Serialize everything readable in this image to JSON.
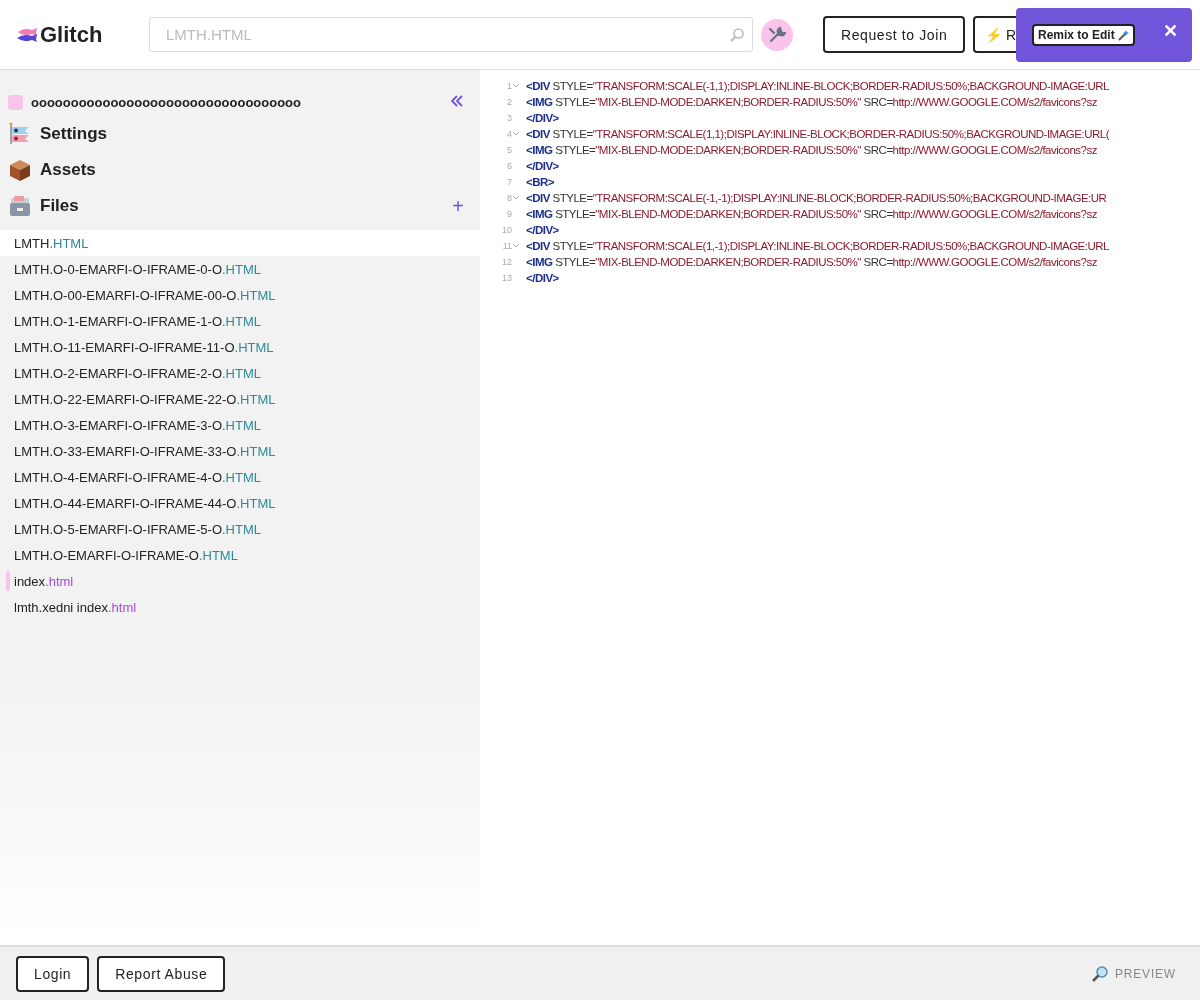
{
  "header": {
    "logo_text": "Glitch",
    "search": {
      "value": "LMTH.HTML"
    },
    "buttons": [
      {
        "kind": "outline",
        "label": "Request to Join"
      },
      {
        "kind": "lightning",
        "icon": "⚡",
        "label": "R"
      }
    ],
    "popover": {
      "button": "Remix to Edit",
      "close": "✕"
    }
  },
  "sidebar": {
    "project_name": "oooooooooooooooooooooooooooooooooo",
    "sections": [
      {
        "kind": "settings",
        "label": "Settings"
      },
      {
        "kind": "assets",
        "label": "Assets"
      },
      {
        "kind": "files",
        "label": "Files",
        "add": "+"
      }
    ],
    "files": [
      {
        "name": "LMTH",
        "ext": ".HTML",
        "color": "#2a8a96",
        "selected": true,
        "marked": false
      },
      {
        "name": "LMTH.O-0-EMARFI-O-IFRAME-0-O",
        "ext": ".HTML",
        "color": "#2a8a96",
        "selected": false,
        "marked": false
      },
      {
        "name": "LMTH.O-00-EMARFI-O-IFRAME-00-O",
        "ext": ".HTML",
        "color": "#2a8a96",
        "selected": false,
        "marked": false
      },
      {
        "name": "LMTH.O-1-EMARFI-O-IFRAME-1-O",
        "ext": ".HTML",
        "color": "#2a8a96",
        "selected": false,
        "marked": false
      },
      {
        "name": "LMTH.O-11-EMARFI-O-IFRAME-11-O",
        "ext": ".HTML",
        "color": "#2a8a96",
        "selected": false,
        "marked": false
      },
      {
        "name": "LMTH.O-2-EMARFI-O-IFRAME-2-O",
        "ext": ".HTML",
        "color": "#2a8a96",
        "selected": false,
        "marked": false
      },
      {
        "name": "LMTH.O-22-EMARFI-O-IFRAME-22-O",
        "ext": ".HTML",
        "color": "#2a8a96",
        "selected": false,
        "marked": false
      },
      {
        "name": "LMTH.O-3-EMARFI-O-IFRAME-3-O",
        "ext": ".HTML",
        "color": "#2a8a96",
        "selected": false,
        "marked": false
      },
      {
        "name": "LMTH.O-33-EMARFI-O-IFRAME-33-O",
        "ext": ".HTML",
        "color": "#2a8a96",
        "selected": false,
        "marked": false
      },
      {
        "name": "LMTH.O-4-EMARFI-O-IFRAME-4-O",
        "ext": ".HTML",
        "color": "#2a8a96",
        "selected": false,
        "marked": false
      },
      {
        "name": "LMTH.O-44-EMARFI-O-IFRAME-44-O",
        "ext": ".HTML",
        "color": "#2a8a96",
        "selected": false,
        "marked": false
      },
      {
        "name": "LMTH.O-5-EMARFI-O-IFRAME-5-O",
        "ext": ".HTML",
        "color": "#2a8a96",
        "selected": false,
        "marked": false
      },
      {
        "name": "LMTH.O-EMARFI-O-IFRAME-O",
        "ext": ".HTML",
        "color": "#2a8a96",
        "selected": false,
        "marked": false
      },
      {
        "name": "index",
        "ext": ".html",
        "color": "#a94ad6",
        "selected": false,
        "marked": true
      },
      {
        "name": "lmth.xedni index",
        "ext": ".html",
        "color": "#a94ad6",
        "selected": false,
        "marked": false
      }
    ]
  },
  "editor": {
    "lines": [
      {
        "number": "1",
        "foldable": true,
        "tokens": [
          {
            "kind": "tag",
            "text": "<DIV"
          },
          {
            "kind": "attr",
            "text": " STYLE="
          },
          {
            "kind": "string",
            "text": "\"TRANSFORM:SCALE(-1,1);DISPLAY:INLINE-BLOCK;BORDER-RADIUS:50%;BACKGROUND-IMAGE:URL"
          }
        ]
      },
      {
        "number": "2",
        "foldable": false,
        "tokens": [
          {
            "kind": "tag",
            "text": "<IMG"
          },
          {
            "kind": "attr",
            "text": " STYLE="
          },
          {
            "kind": "string",
            "text": "\"MIX-BLEND-MODE:DARKEN;BORDER-RADIUS:50%\""
          },
          {
            "kind": "attr",
            "text": " SRC="
          },
          {
            "kind": "string",
            "text": "http://WWW.GOOGLE.COM/s2/favicons?sz"
          }
        ]
      },
      {
        "number": "3",
        "foldable": false,
        "tokens": [
          {
            "kind": "tag",
            "text": "</DIV>"
          }
        ]
      },
      {
        "number": "4",
        "foldable": true,
        "tokens": [
          {
            "kind": "tag",
            "text": "<DIV"
          },
          {
            "kind": "attr",
            "text": " STYLE="
          },
          {
            "kind": "string",
            "text": "\"TRANSFORM:SCALE(1,1);DISPLAY:INLINE-BLOCK;BORDER-RADIUS:50%;BACKGROUND-IMAGE:URL("
          }
        ]
      },
      {
        "number": "5",
        "foldable": false,
        "tokens": [
          {
            "kind": "tag",
            "text": "<IMG"
          },
          {
            "kind": "attr",
            "text": " STYLE="
          },
          {
            "kind": "string",
            "text": "\"MIX-BLEND-MODE:DARKEN;BORDER-RADIUS:50%\""
          },
          {
            "kind": "attr",
            "text": " SRC="
          },
          {
            "kind": "string",
            "text": "http://WWW.GOOGLE.COM/s2/favicons?sz"
          }
        ]
      },
      {
        "number": "6",
        "foldable": false,
        "tokens": [
          {
            "kind": "tag",
            "text": "</DIV>"
          }
        ]
      },
      {
        "number": "7",
        "foldable": false,
        "tokens": [
          {
            "kind": "tag",
            "text": "<BR>"
          }
        ]
      },
      {
        "number": "8",
        "foldable": true,
        "tokens": [
          {
            "kind": "tag",
            "text": "<DIV"
          },
          {
            "kind": "attr",
            "text": " STYLE="
          },
          {
            "kind": "string",
            "text": "\"TRANSFORM:SCALE(-1,-1);DISPLAY:INLINE-BLOCK;BORDER-RADIUS:50%;BACKGROUND-IMAGE:UR"
          }
        ]
      },
      {
        "number": "9",
        "foldable": false,
        "tokens": [
          {
            "kind": "tag",
            "text": "<IMG"
          },
          {
            "kind": "attr",
            "text": " STYLE="
          },
          {
            "kind": "string",
            "text": "\"MIX-BLEND-MODE:DARKEN;BORDER-RADIUS:50%\""
          },
          {
            "kind": "attr",
            "text": " SRC="
          },
          {
            "kind": "string",
            "text": "http://WWW.GOOGLE.COM/s2/favicons?sz"
          }
        ]
      },
      {
        "number": "10",
        "foldable": false,
        "tokens": [
          {
            "kind": "tag",
            "text": "</DIV>"
          }
        ]
      },
      {
        "number": "11",
        "foldable": true,
        "tokens": [
          {
            "kind": "tag",
            "text": "<DIV"
          },
          {
            "kind": "attr",
            "text": " STYLE="
          },
          {
            "kind": "string",
            "text": "\"TRANSFORM:SCALE(1,-1);DISPLAY:INLINE-BLOCK;BORDER-RADIUS:50%;BACKGROUND-IMAGE:URL"
          }
        ]
      },
      {
        "number": "12",
        "foldable": false,
        "tokens": [
          {
            "kind": "tag",
            "text": "<IMG"
          },
          {
            "kind": "attr",
            "text": " STYLE="
          },
          {
            "kind": "string",
            "text": "\"MIX-BLEND-MODE:DARKEN;BORDER-RADIUS:50%\""
          },
          {
            "kind": "attr",
            "text": " SRC="
          },
          {
            "kind": "string",
            "text": "http://WWW.GOOGLE.COM/s2/favicons?sz"
          }
        ]
      },
      {
        "number": "13",
        "foldable": false,
        "tokens": [
          {
            "kind": "tag",
            "text": "</DIV>"
          }
        ]
      }
    ]
  },
  "footer": {
    "buttons": [
      "Login",
      "Report Abuse"
    ],
    "preview": "PREVIEW"
  }
}
